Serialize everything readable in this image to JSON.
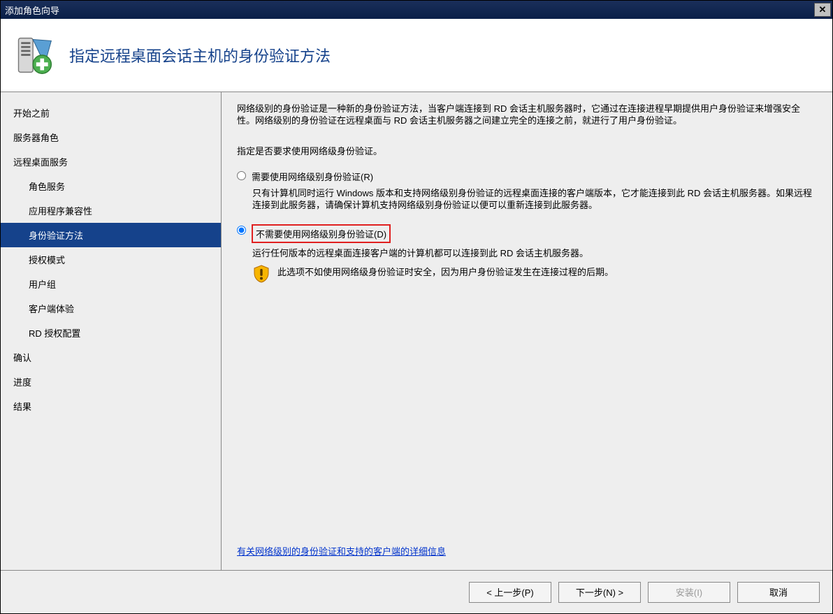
{
  "titlebar": {
    "text": "添加角色向导",
    "close_glyph": "✕"
  },
  "header": {
    "title": "指定远程桌面会话主机的身份验证方法"
  },
  "sidebar": {
    "items": [
      {
        "label": "开始之前",
        "indent": 0
      },
      {
        "label": "服务器角色",
        "indent": 0
      },
      {
        "label": "远程桌面服务",
        "indent": 0
      },
      {
        "label": "角色服务",
        "indent": 1
      },
      {
        "label": "应用程序兼容性",
        "indent": 1
      },
      {
        "label": "身份验证方法",
        "indent": 1,
        "selected": true
      },
      {
        "label": "授权模式",
        "indent": 1
      },
      {
        "label": "用户组",
        "indent": 1
      },
      {
        "label": "客户端体验",
        "indent": 1
      },
      {
        "label": "RD 授权配置",
        "indent": 1
      },
      {
        "label": "确认",
        "indent": 0
      },
      {
        "label": "进度",
        "indent": 0
      },
      {
        "label": "结果",
        "indent": 0
      }
    ]
  },
  "content": {
    "intro": "网络级别的身份验证是一种新的身份验证方法，当客户端连接到 RD 会话主机服务器时，它通过在连接进程早期提供用户身份验证来增强安全性。网络级别的身份验证在远程桌面与 RD 会话主机服务器之间建立完全的连接之前，就进行了用户身份验证。",
    "prompt": "指定是否要求使用网络级身份验证。",
    "opt1": {
      "label": "需要使用网络级别身份验证(R)",
      "desc": "只有计算机同时运行 Windows 版本和支持网络级别身份验证的远程桌面连接的客户端版本，它才能连接到此 RD 会话主机服务器。如果远程连接到此服务器，请确保计算机支持网络级别身份验证以便可以重新连接到此服务器。"
    },
    "opt2": {
      "label": "不需要使用网络级别身份验证(D)",
      "desc": "运行任何版本的远程桌面连接客户端的计算机都可以连接到此 RD 会话主机服务器。",
      "warn": "此选项不如使用网络级身份验证时安全，因为用户身份验证发生在连接过程的后期。"
    },
    "link": "有关网络级别的身份验证和支持的客户端的详细信息"
  },
  "footer": {
    "prev": "< 上一步(P)",
    "next": "下一步(N) >",
    "install": "安装(I)",
    "cancel": "取消"
  }
}
